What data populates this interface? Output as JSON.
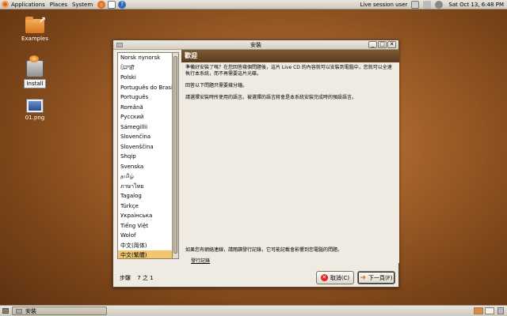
{
  "topbar": {
    "menus": [
      "Applications",
      "Places",
      "System"
    ],
    "session": "Live session user",
    "clock": "Sat Oct 13,  6:48 PM"
  },
  "desktop": {
    "icons": [
      {
        "label": "Examples",
        "icon": "folder-icon"
      },
      {
        "label": "Install",
        "icon": "install-disk-icon"
      },
      {
        "label": "01.png",
        "icon": "image-file-icon"
      }
    ]
  },
  "window": {
    "title": "安裝",
    "languages": [
      "Norsk nynorsk",
      "ਪੰਜਾਬੀ",
      "Polski",
      "Português do Brasil",
      "Português",
      "Română",
      "Русский",
      "Sámegillii",
      "Slovenčina",
      "Slovenščina",
      "Shqip",
      "Svenska",
      "தமிழ்",
      "ภาษาไทย",
      "Tagalog",
      "Türkçe",
      "Українська",
      "Tiếng Việt",
      "Wolof",
      "中文(简体)",
      "中文(繁體)"
    ],
    "selected_language": "中文(繁體)",
    "heading": "歡迎",
    "para1": "準備好安裝了嗎？在您回答幾個問題後，這片 Live CD 的內容就可以安裝到電腦中，您就可以全速執行本系統，而不再需要這片光碟。",
    "para2": "回答以下問題只需要幾分鐘。",
    "para3": "請選擇安裝時所使用的語言。被選擇的語言將會是本系統安裝完成時的預設語言。",
    "para4": "如果您有網絡連線，請閱讀發行記錄，它可能記載會影響到您電腦的問題。",
    "release_notes_link": "發行記錄",
    "step_label": "步驟",
    "step_value": "7 之 1",
    "cancel_label": "取消(C)",
    "next_label": "下一頁(F)"
  },
  "bottombar": {
    "task_label": "安裝"
  },
  "colors": {
    "header_bg": "#6b4a28",
    "selection": "#f2c76b",
    "panel": "#e9e5dc"
  }
}
